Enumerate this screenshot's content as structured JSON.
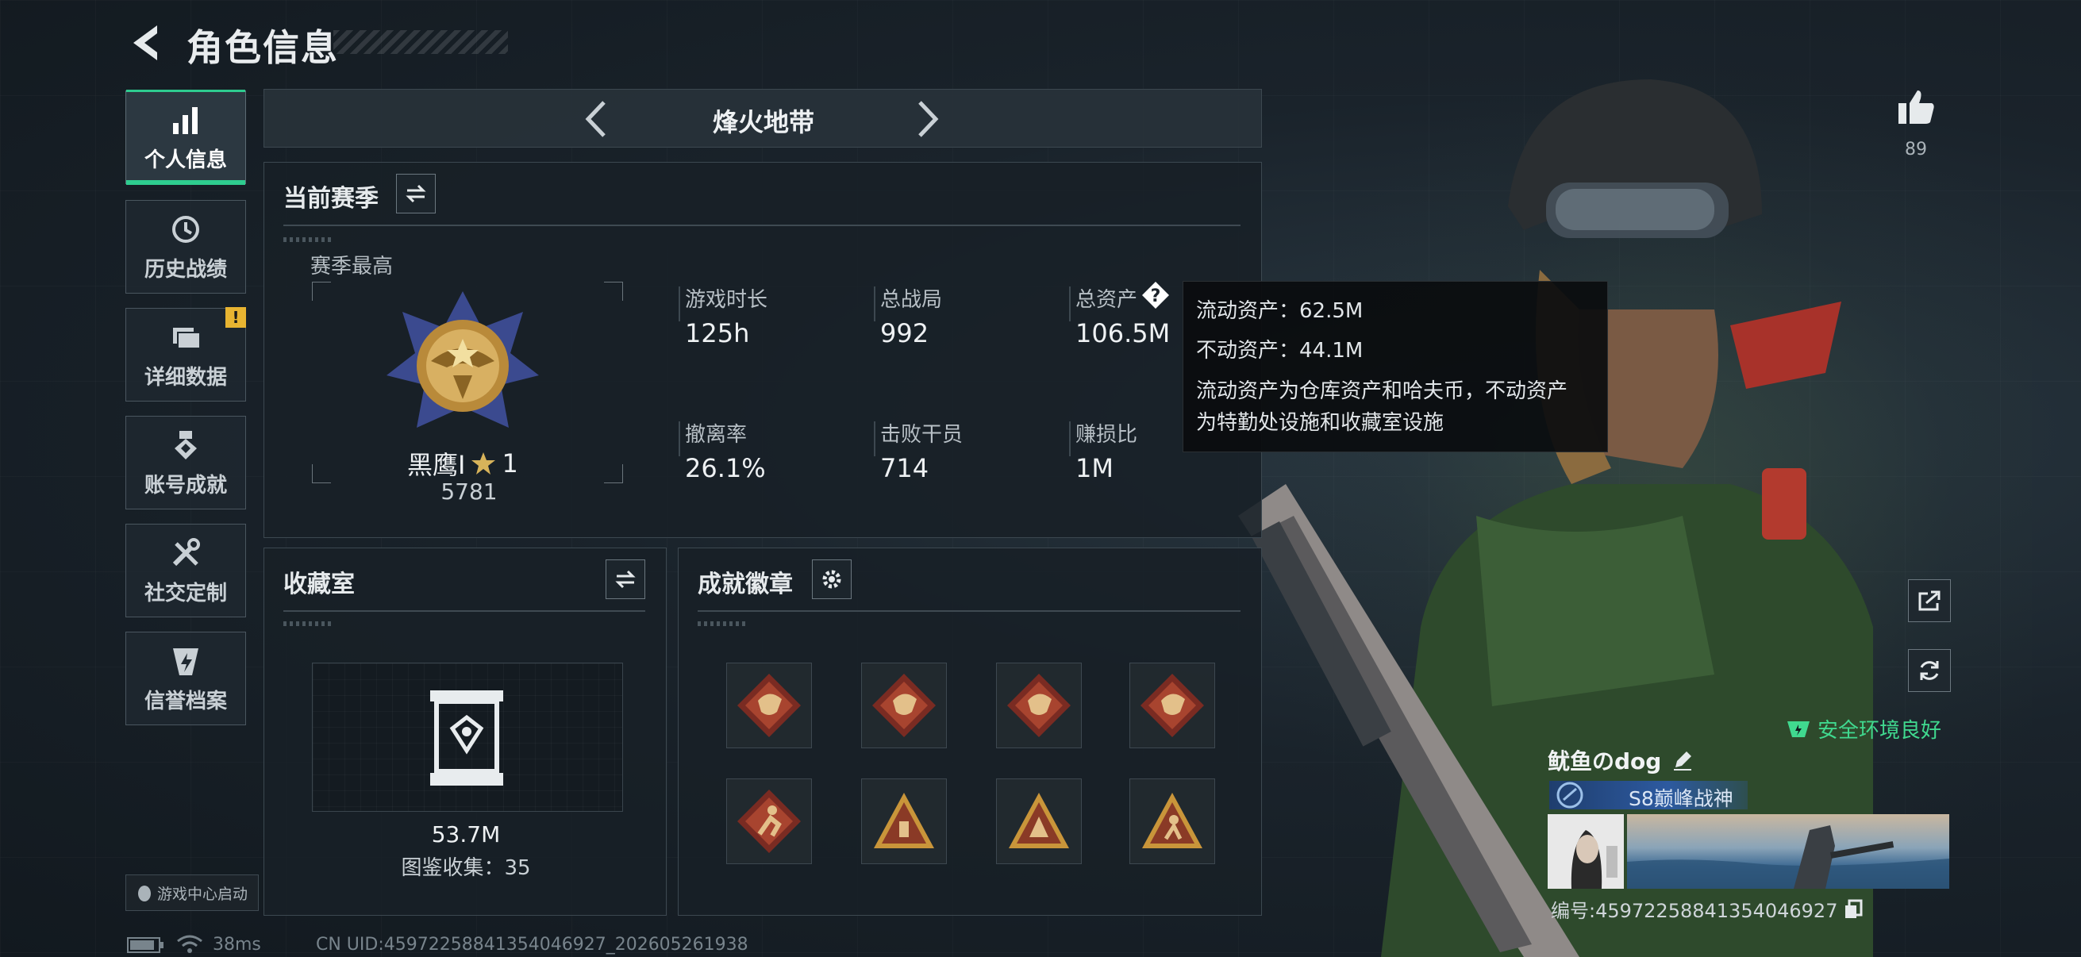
{
  "header": {
    "title": "角色信息"
  },
  "sidebar": {
    "items": [
      {
        "label": "个人信息",
        "icon": "bar-chart-icon",
        "active": true
      },
      {
        "label": "历史战绩",
        "icon": "history-clock-icon"
      },
      {
        "label": "详细数据",
        "icon": "folder-icon",
        "badge": "!"
      },
      {
        "label": "账号成就",
        "icon": "medal-icon"
      },
      {
        "label": "社交定制",
        "icon": "tools-icon"
      },
      {
        "label": "信誉档案",
        "icon": "shield-bolt-icon"
      }
    ],
    "launch_label": "游戏中心启动"
  },
  "mode": {
    "name": "烽火地带"
  },
  "season": {
    "title": "当前赛季",
    "best_label": "赛季最高",
    "rank_name": "黑鹰I",
    "rank_stars": "1",
    "rank_score": "5781",
    "stats": [
      {
        "label": "游戏时长",
        "value": "125h"
      },
      {
        "label": "总战局",
        "value": "992"
      },
      {
        "label": "总资产",
        "value": "106.5M"
      },
      {
        "label": "撤离率",
        "value": "26.1%"
      },
      {
        "label": "击败干员",
        "value": "714"
      },
      {
        "label": "赚损比",
        "value": "1M"
      }
    ]
  },
  "tooltip": {
    "liquid": "流动资产：62.5M",
    "fixed": "不动资产：44.1M",
    "desc1": "流动资产为仓库资产和哈夫币，不动资产",
    "desc2": "为特勤处设施和收藏室设施"
  },
  "collection": {
    "title": "收藏室",
    "value": "53.7M",
    "gallery": "图鉴收集：35"
  },
  "achievements": {
    "title": "成就徽章",
    "badges": [
      "dragon-badge-icon",
      "dragon-badge-icon",
      "dragon-badge-icon",
      "dragon-badge-icon",
      "runner-badge-icon",
      "pyramid-badge-icon",
      "triangle-badge-icon",
      "triangle-figure-badge-icon"
    ]
  },
  "profile": {
    "likes": "89",
    "player_name": "鱿鱼のdog",
    "title": "S8巅峰战神",
    "safe_env": "安全环境良好",
    "uid": "编号:4597225884135404692​7"
  },
  "status": {
    "ping": "38ms",
    "uid_line": "CN UID:4597225884135404692​7_202605261938"
  },
  "colors": {
    "accent": "#2ecc8f",
    "warn": "#e8b431",
    "title_blue": "#2d5aa0"
  }
}
